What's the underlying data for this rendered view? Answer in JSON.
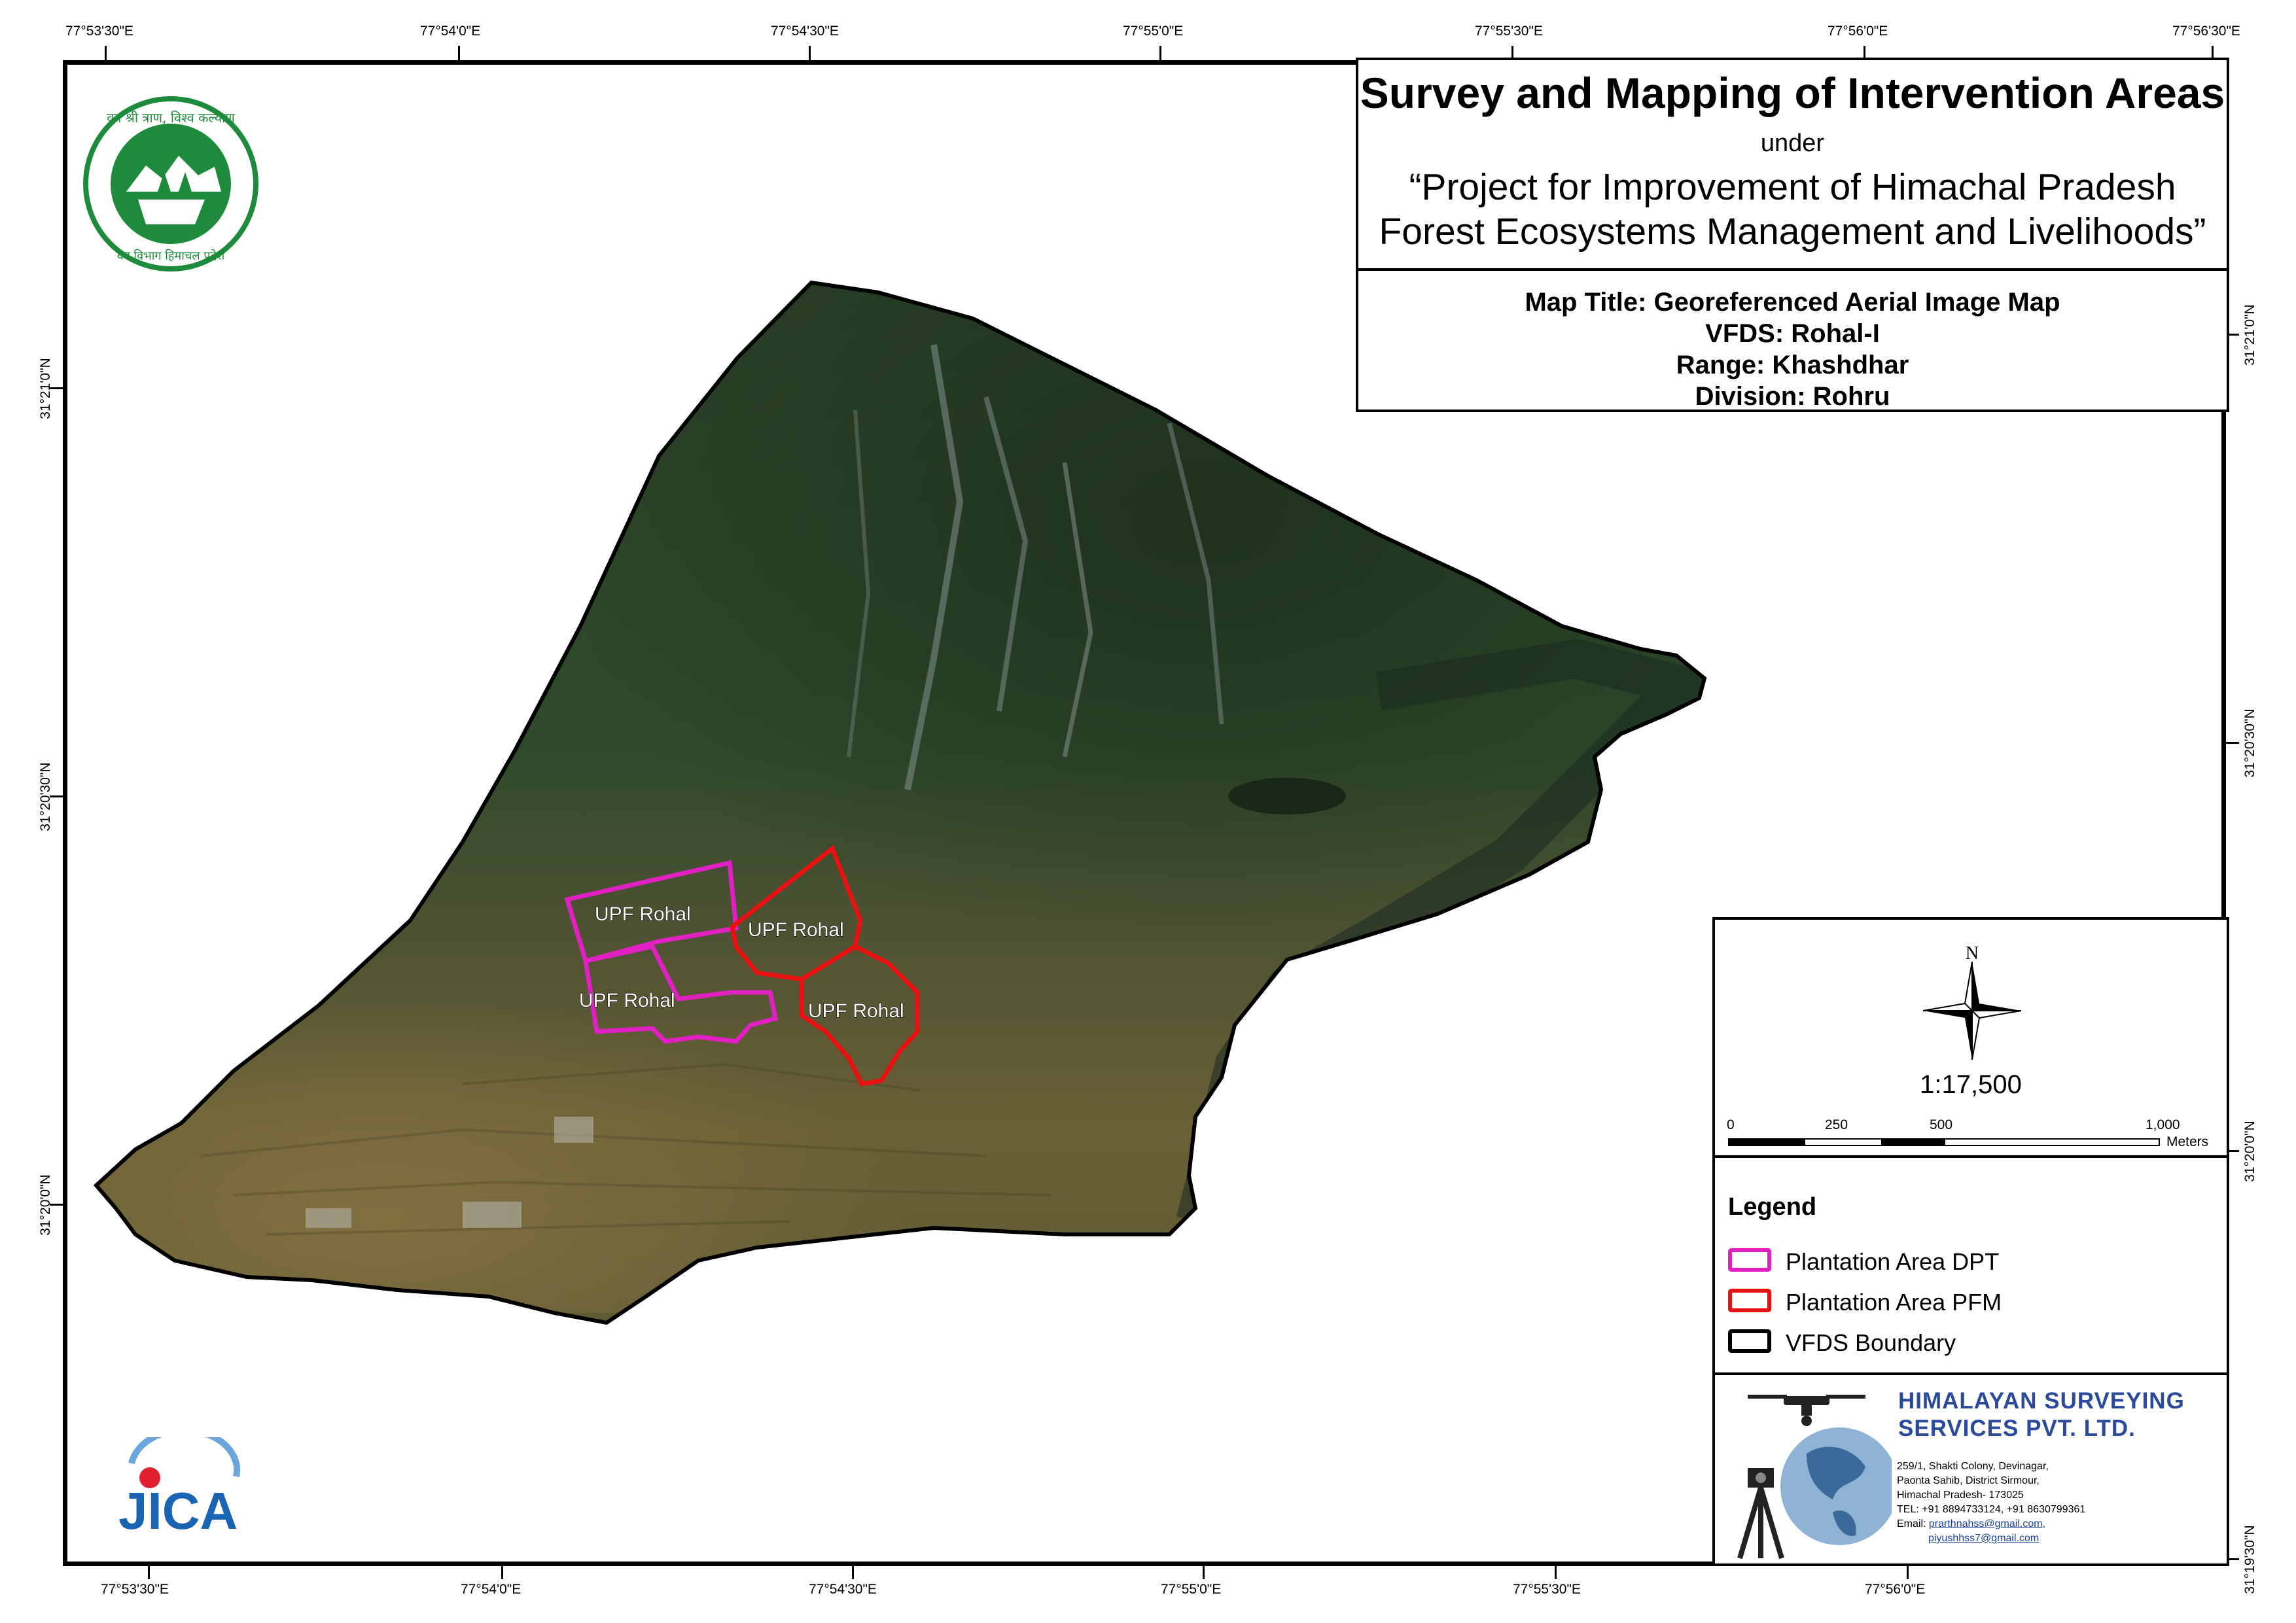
{
  "coords": {
    "top": [
      "77°53'30\"E",
      "77°54'0\"E",
      "77°54'30\"E",
      "77°55'0\"E",
      "77°55'30\"E",
      "77°56'0\"E",
      "77°56'30\"E"
    ],
    "bottom": [
      "77°53'30\"E",
      "77°54'0\"E",
      "77°54'30\"E",
      "77°55'0\"E",
      "77°55'30\"E",
      "77°56'0\"E"
    ],
    "left": [
      "31°21'0\"N",
      "31°20'30\"N",
      "31°20'0\"N"
    ],
    "right": [
      "31°21'0\"N",
      "31°20'30\"N",
      "31°20'0\"N",
      "31°19'30\"N"
    ]
  },
  "title": {
    "main": "Survey and Mapping of Intervention Areas",
    "under": "under",
    "project_line1": "“Project for Improvement of Himachal Pradesh",
    "project_line2": "Forest Ecosystems Management and Livelihoods”",
    "map_title": "Map Title: Georeferenced Aerial Image Map",
    "vfds": "VFDS: Rohal-I",
    "range": "Range: Khashdhar",
    "division": "Division: Rohru"
  },
  "map_labels": {
    "dpt_upper": "UPF Rohal",
    "dpt_lower": "UPF Rohal",
    "pfm_upper": "UPF Rohal",
    "pfm_lower": "UPF Rohal"
  },
  "north_arrow": {
    "label": "N"
  },
  "scale": {
    "ratio": "1:17,500",
    "ticks": [
      "0",
      "250",
      "500",
      "1,000"
    ],
    "unit": "Meters"
  },
  "legend": {
    "title": "Legend",
    "items": [
      {
        "label": "Plantation Area DPT",
        "color": "#e020c0"
      },
      {
        "label": "Plantation Area PFM",
        "color": "#e81010"
      },
      {
        "label": "VFDS Boundary",
        "color": "#000000"
      }
    ]
  },
  "logos": {
    "hp_forest_top_text": "वन श्री त्राण, विश्व कल्याण",
    "hp_forest_bottom_text": "वन विभाग हिमाचल प्रदेश",
    "jica": "JICA"
  },
  "company": {
    "name_line1": "HIMALAYAN SURVEYING",
    "name_line2": "SERVICES PVT. LTD.",
    "address": [
      "259/1, Shakti Colony, Devinagar,",
      "Paonta Sahib, District Sirmour,",
      "Himachal Pradesh- 173025",
      "TEL: +91 8894733124, +91 8630799361"
    ],
    "email_label": "Email:",
    "email1": "prarthnahss@gmail.com,",
    "email2": "piyushhss7@gmail.com"
  },
  "colors": {
    "dpt": "#e020c0",
    "pfm": "#e81010",
    "boundary": "#000000",
    "forest": "#2c4a2a",
    "company_blue": "#2b4a9c",
    "hp_green": "#1e8a3c",
    "jica_blue": "#1a64b4",
    "jica_red": "#e02030"
  }
}
